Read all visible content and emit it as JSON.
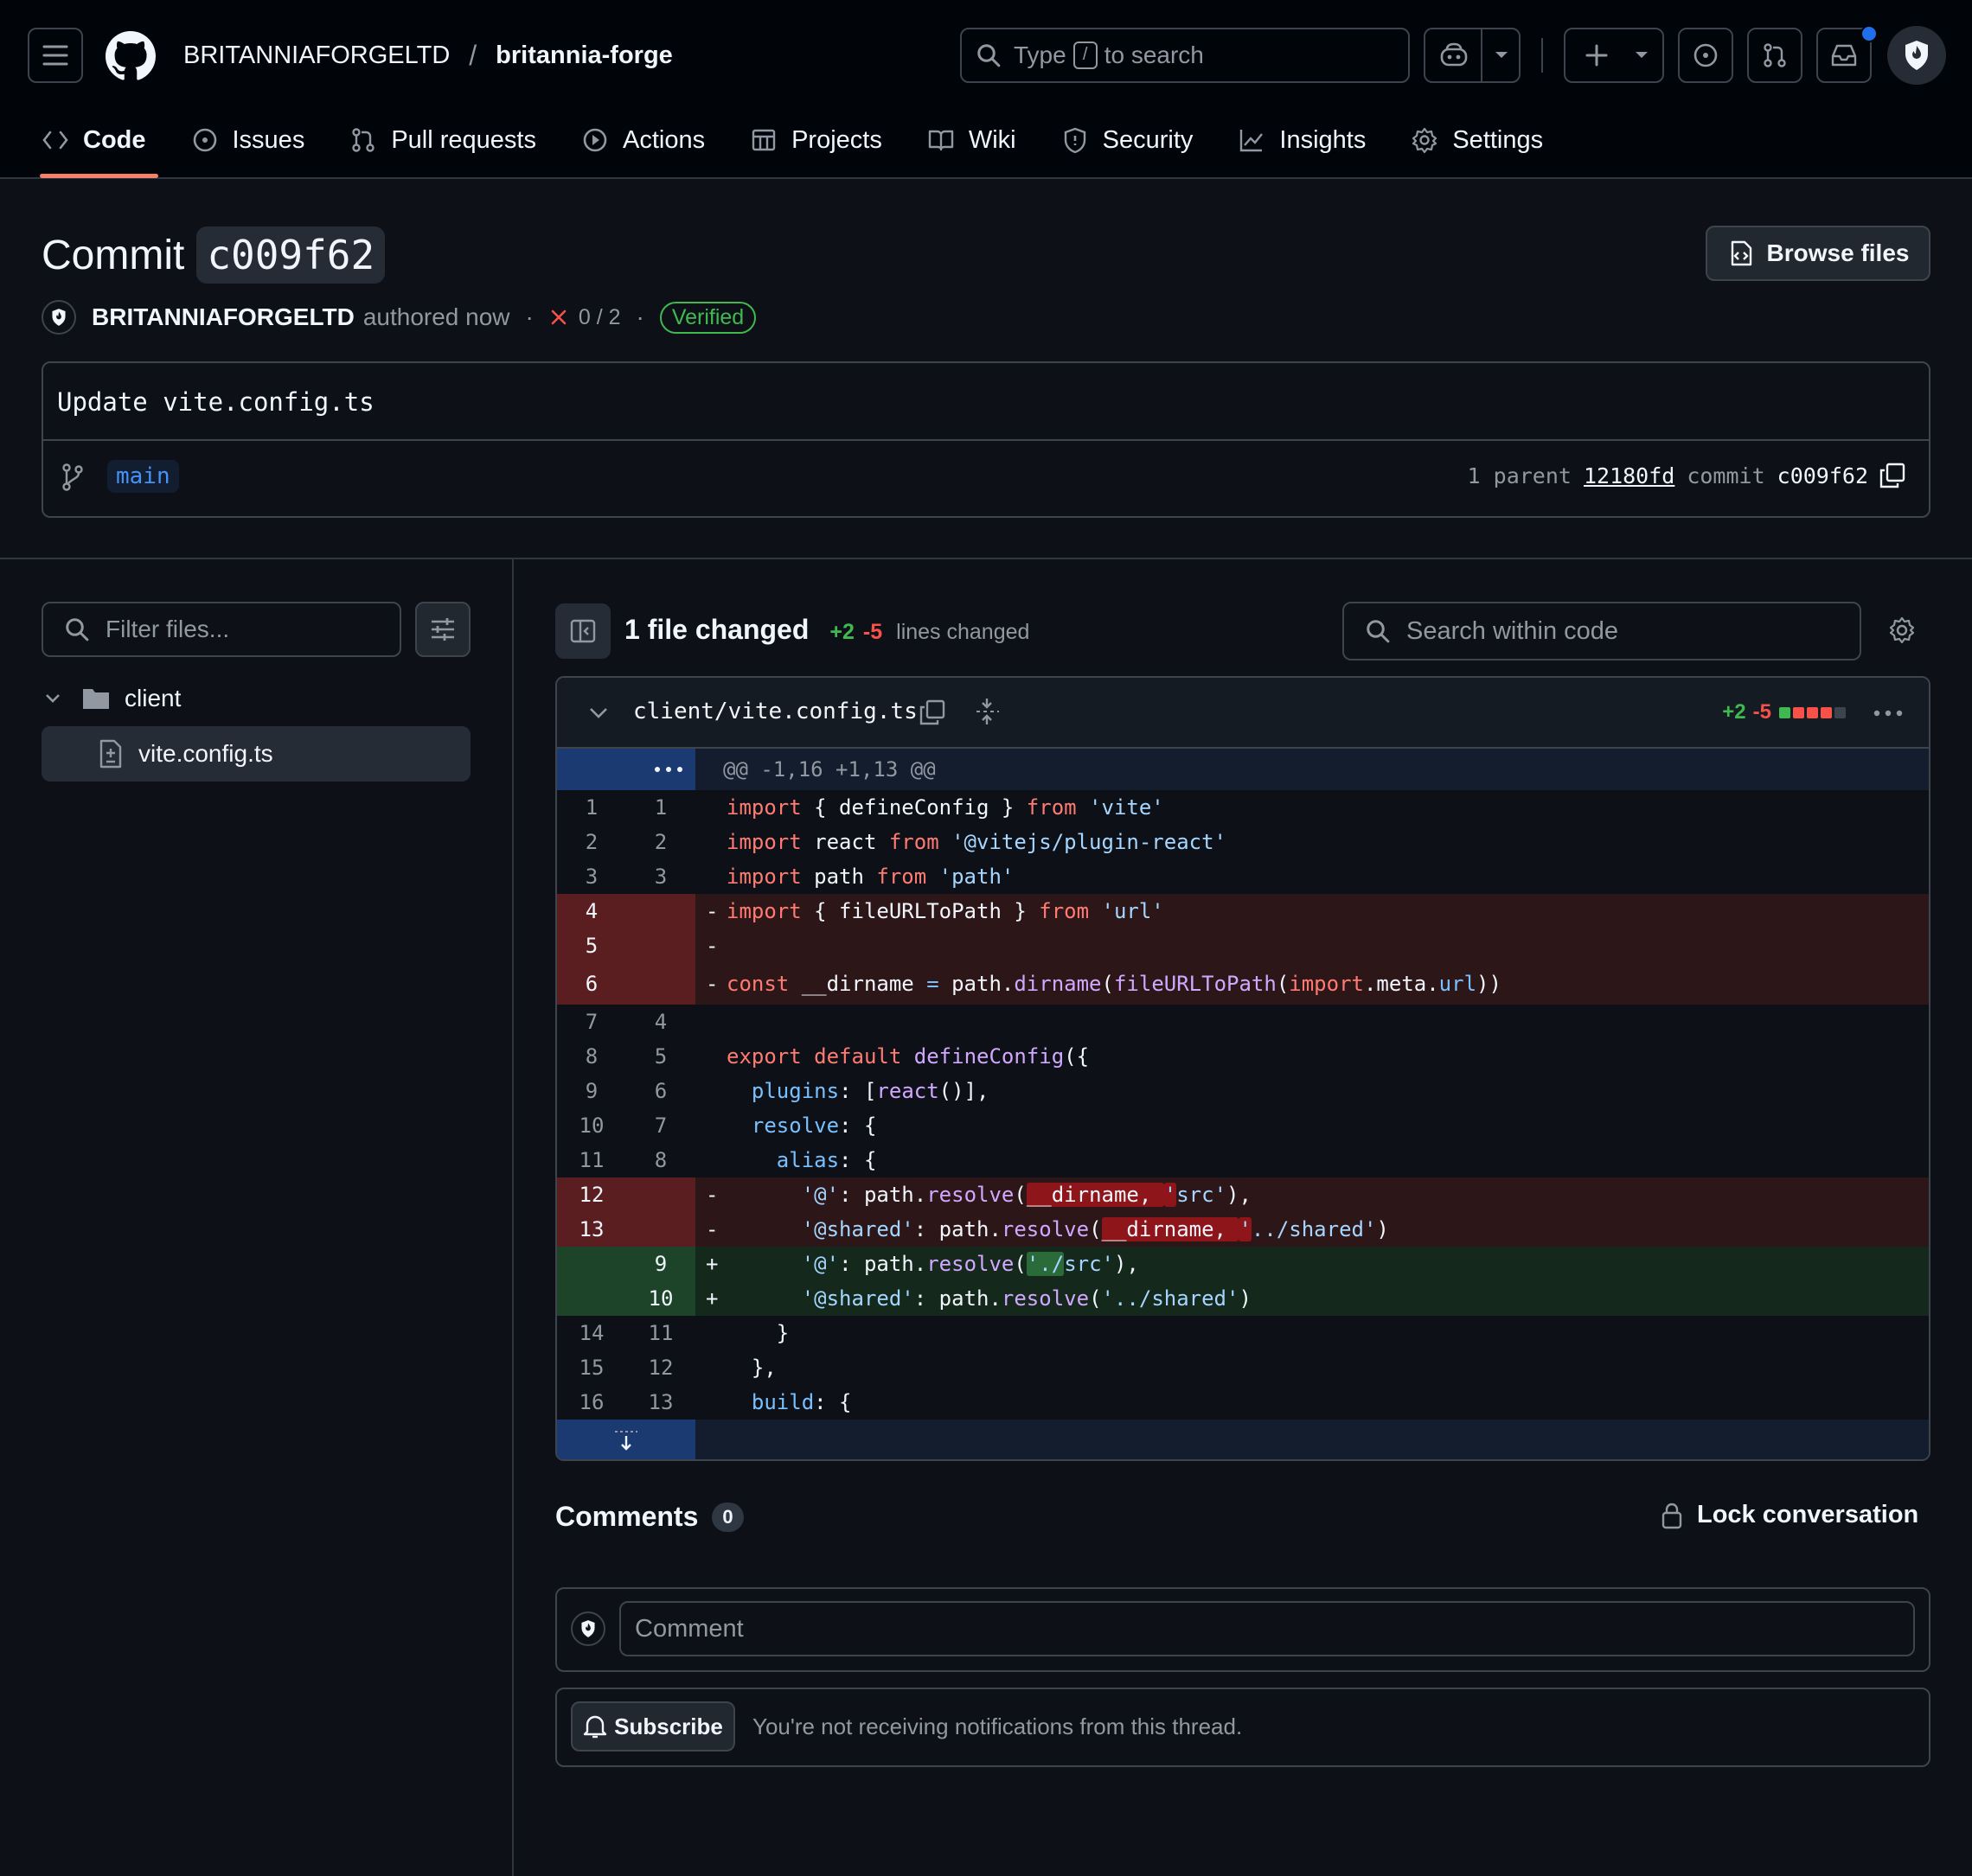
{
  "header": {
    "owner": "BRITANNIAFORGELTD",
    "separator": "/",
    "repo": "britannia-forge",
    "search_prefix": "Type",
    "search_key": "/",
    "search_suffix": "to search"
  },
  "nav": {
    "tabs": [
      {
        "label": "Code",
        "icon": "code-icon",
        "active": true
      },
      {
        "label": "Issues",
        "icon": "issue-icon"
      },
      {
        "label": "Pull requests",
        "icon": "pull-request-icon"
      },
      {
        "label": "Actions",
        "icon": "play-icon"
      },
      {
        "label": "Projects",
        "icon": "table-icon"
      },
      {
        "label": "Wiki",
        "icon": "book-icon"
      },
      {
        "label": "Security",
        "icon": "shield-icon"
      },
      {
        "label": "Insights",
        "icon": "graph-icon"
      },
      {
        "label": "Settings",
        "icon": "gear-icon"
      }
    ]
  },
  "commit": {
    "title_prefix": "Commit",
    "short_sha": "c009f62",
    "browse_label": "Browse files",
    "author": "BRITANNIAFORGELTD",
    "authored": "authored now",
    "checks": "0 / 2",
    "verified": "Verified",
    "message": "Update vite.config.ts",
    "branch": "main",
    "parent_count_label": "1 parent",
    "parent_sha": "12180fd",
    "commit_label": "commit",
    "commit_sha": "c009f62"
  },
  "filetree": {
    "filter_placeholder": "Filter files...",
    "folder": "client",
    "file": "vite.config.ts"
  },
  "diff_toolbar": {
    "files_changed": "1 file changed",
    "additions": "+2",
    "deletions": "-5",
    "lines_changed": "lines changed",
    "search_placeholder": "Search within code"
  },
  "file": {
    "path": "client/vite.config.ts",
    "additions": "+2",
    "deletions": "-5",
    "hunk": "@@ -1,16 +1,13 @@",
    "stat_squares": [
      "add",
      "del",
      "del",
      "del",
      "neutral"
    ],
    "colors": {
      "add": "#3fb950",
      "del": "#f85149",
      "neutral": "#3d444d"
    }
  },
  "diff_lines": [
    {
      "type": "ctx",
      "old": "1",
      "new": "1",
      "marker": " ",
      "code": "import { defineConfig } from 'vite'"
    },
    {
      "type": "ctx",
      "old": "2",
      "new": "2",
      "marker": " ",
      "code": "import react from '@vitejs/plugin-react'"
    },
    {
      "type": "ctx",
      "old": "3",
      "new": "3",
      "marker": " ",
      "code": "import path from 'path'"
    },
    {
      "type": "del",
      "old": "4",
      "new": "",
      "marker": "-",
      "code": "import { fileURLToPath } from 'url'"
    },
    {
      "type": "del",
      "old": "5",
      "new": "",
      "marker": "-",
      "code": ""
    },
    {
      "type": "del",
      "old": "6",
      "new": "",
      "marker": "-",
      "code": "const __dirname = path.dirname(fileURLToPath(import.meta.url))"
    },
    {
      "type": "ctx",
      "old": "7",
      "new": "4",
      "marker": " ",
      "code": ""
    },
    {
      "type": "ctx",
      "old": "8",
      "new": "5",
      "marker": " ",
      "code": "export default defineConfig({"
    },
    {
      "type": "ctx",
      "old": "9",
      "new": "6",
      "marker": " ",
      "code": "  plugins: [react()],"
    },
    {
      "type": "ctx",
      "old": "10",
      "new": "7",
      "marker": " ",
      "code": "  resolve: {"
    },
    {
      "type": "ctx",
      "old": "11",
      "new": "8",
      "marker": " ",
      "code": "    alias: {"
    },
    {
      "type": "del",
      "old": "12",
      "new": "",
      "marker": "-",
      "code": "      '@': path.resolve(__dirname, 'src'),"
    },
    {
      "type": "del",
      "old": "13",
      "new": "",
      "marker": "-",
      "code": "      '@shared': path.resolve(__dirname, '../shared')"
    },
    {
      "type": "add",
      "old": "",
      "new": "9",
      "marker": "+",
      "code": "      '@': path.resolve('./src'),"
    },
    {
      "type": "add",
      "old": "",
      "new": "10",
      "marker": "+",
      "code": "      '@shared': path.resolve('../shared')"
    },
    {
      "type": "ctx",
      "old": "14",
      "new": "11",
      "marker": " ",
      "code": "    }"
    },
    {
      "type": "ctx",
      "old": "15",
      "new": "12",
      "marker": " ",
      "code": "  },"
    },
    {
      "type": "ctx",
      "old": "16",
      "new": "13",
      "marker": " ",
      "code": "  build: {"
    }
  ],
  "comments": {
    "title": "Comments",
    "count": "0",
    "lock_label": "Lock conversation",
    "comment_placeholder": "Comment",
    "subscribe_label": "Subscribe",
    "subscribe_note": "You're not receiving notifications from this thread."
  }
}
